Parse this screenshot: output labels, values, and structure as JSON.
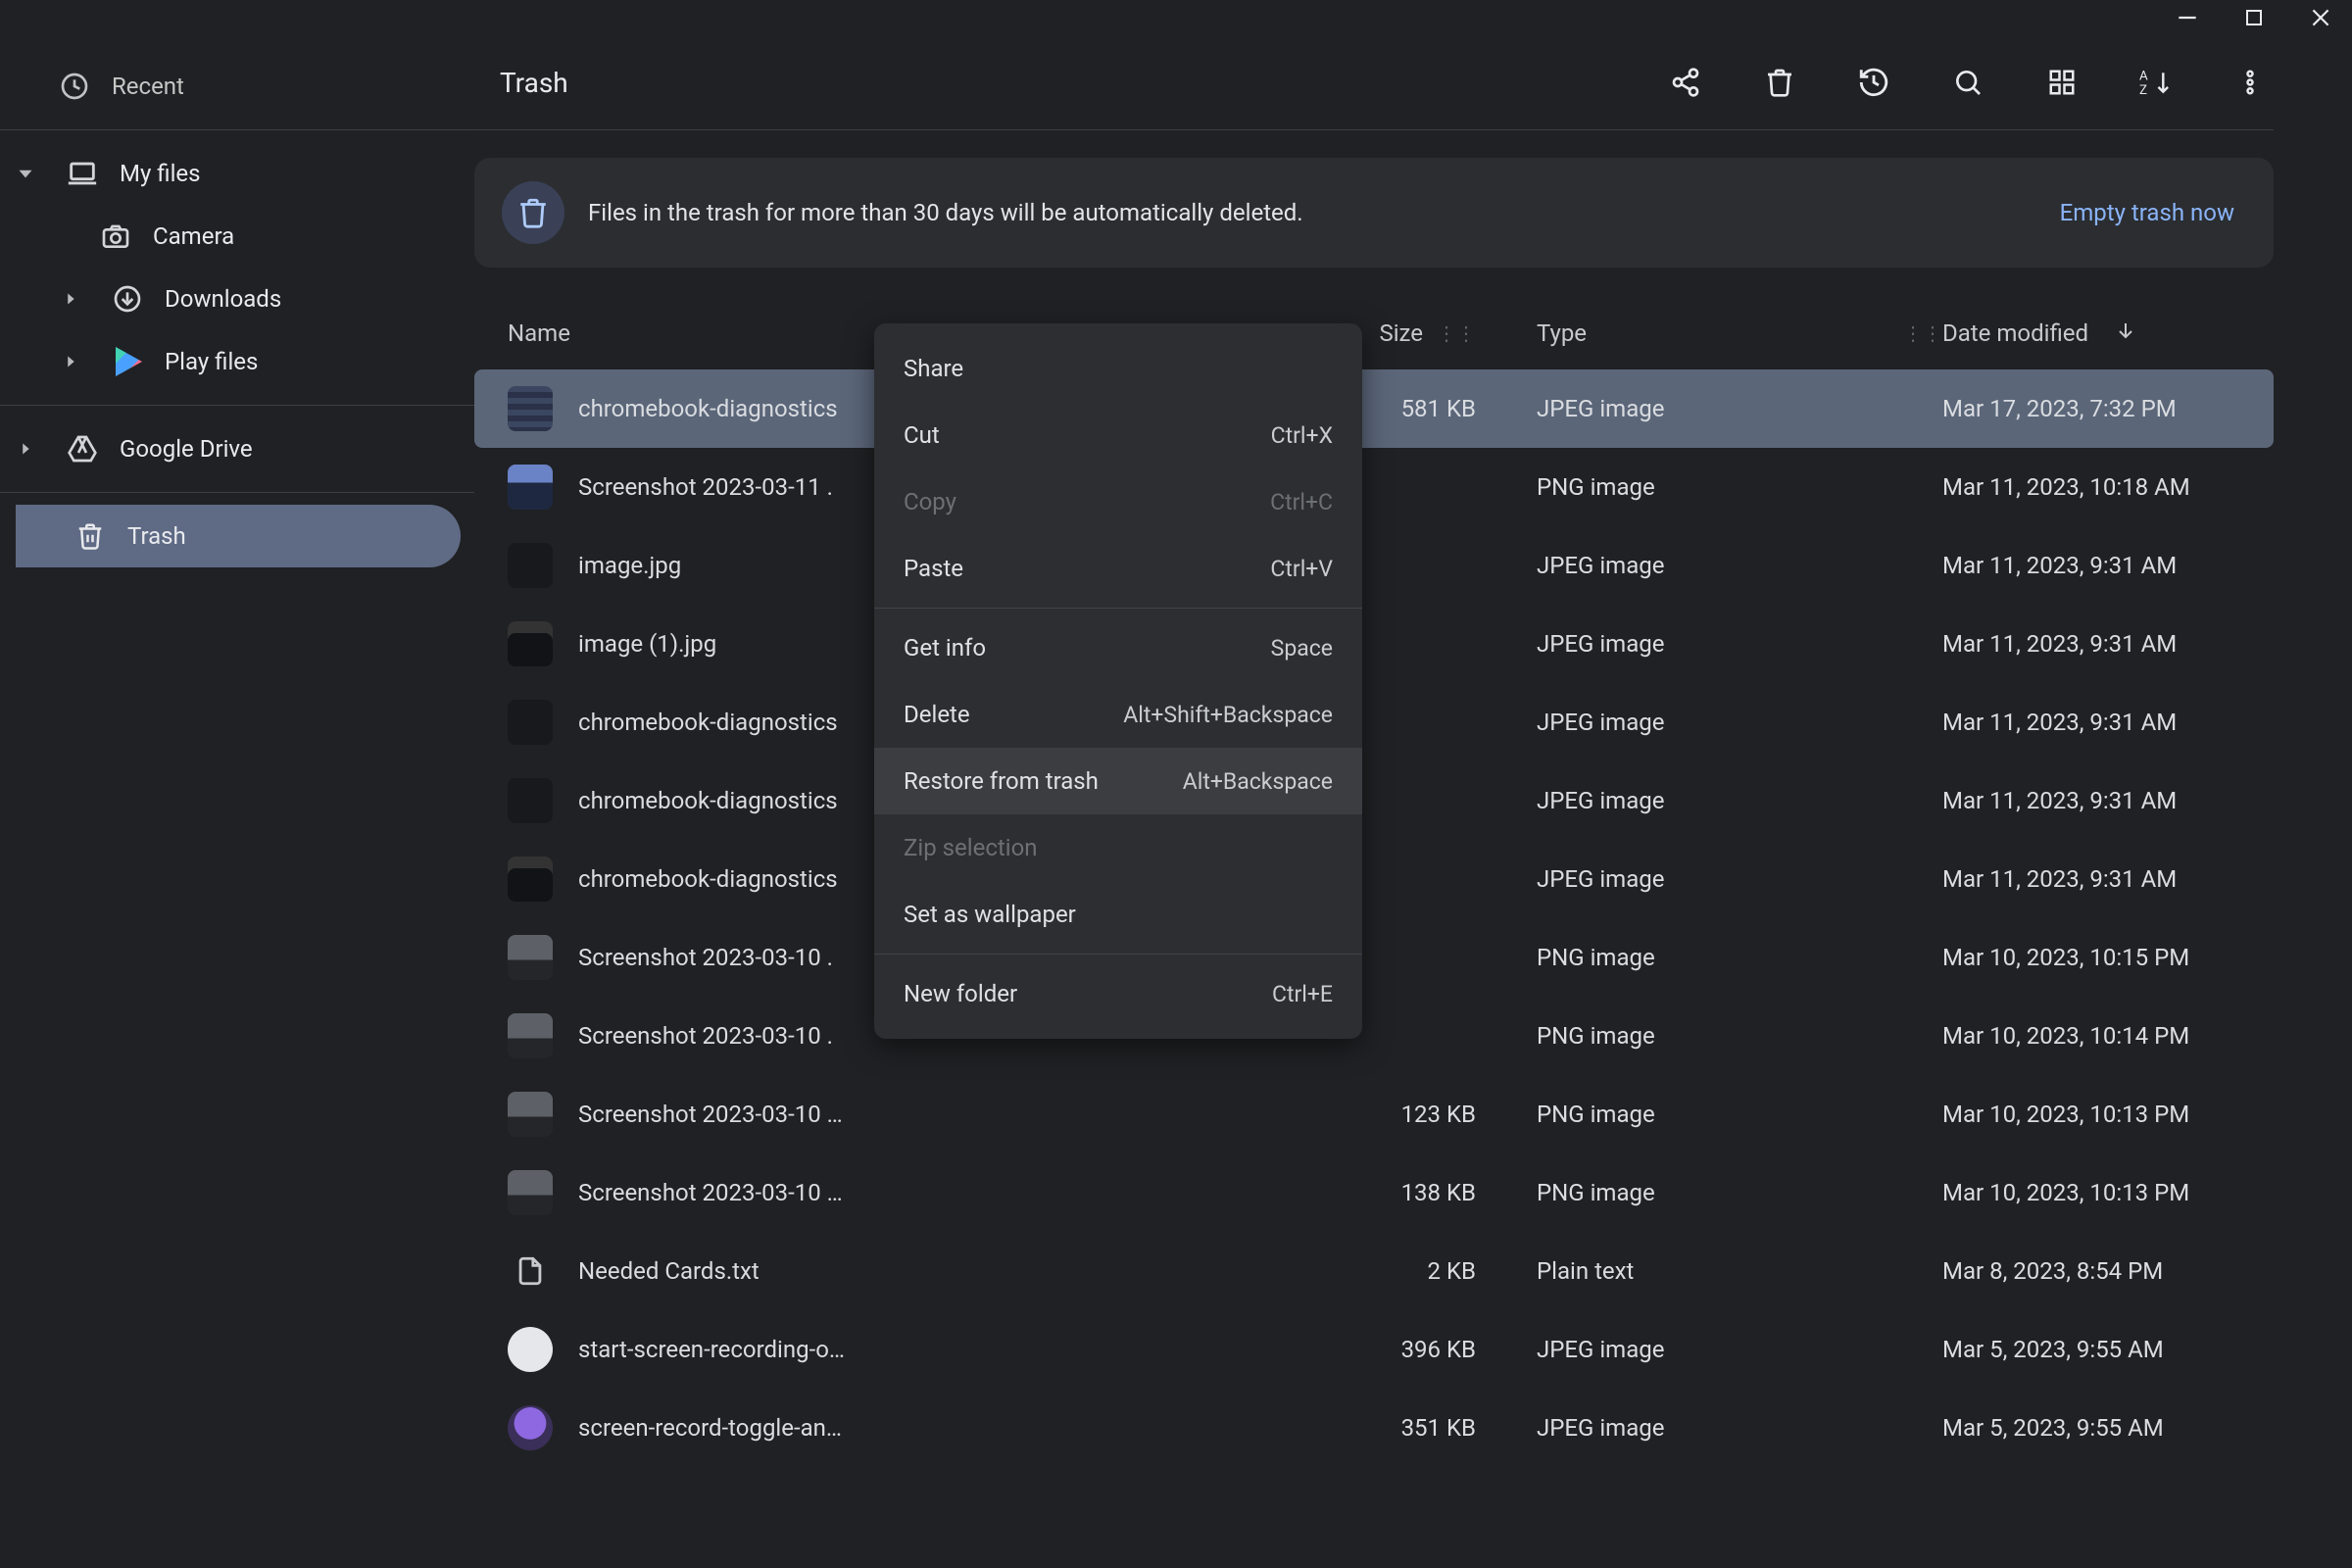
{
  "window": {
    "minimize": "−",
    "maximize": "❐",
    "close": "✕"
  },
  "sidebar": {
    "recent": "Recent",
    "myfiles": "My files",
    "camera": "Camera",
    "downloads": "Downloads",
    "playfiles": "Play files",
    "drive": "Google Drive",
    "trash": "Trash"
  },
  "header": {
    "title": "Trash"
  },
  "banner": {
    "text": "Files in the trash for more than 30 days will be automatically deleted.",
    "action": "Empty trash now"
  },
  "columns": {
    "name": "Name",
    "size": "Size",
    "type": "Type",
    "date": "Date modified"
  },
  "rows": [
    {
      "name": "chromebook-diagnostics",
      "size": "581 KB",
      "type": "JPEG image",
      "date": "Mar 17, 2023, 7:32 PM",
      "thumb": "jpeg-lines",
      "selected": true
    },
    {
      "name": "Screenshot 2023-03-11 .",
      "size": "",
      "type": "PNG image",
      "date": "Mar 11, 2023, 10:18 AM",
      "thumb": "png-bright"
    },
    {
      "name": "image.jpg",
      "size": "",
      "type": "JPEG image",
      "date": "Mar 11, 2023, 9:31 AM",
      "thumb": "jpeg-dark"
    },
    {
      "name": "image (1).jpg",
      "size": "",
      "type": "JPEG image",
      "date": "Mar 11, 2023, 9:31 AM",
      "thumb": "jpeg-dark2"
    },
    {
      "name": "chromebook-diagnostics",
      "size": "",
      "type": "JPEG image",
      "date": "Mar 11, 2023, 9:31 AM",
      "thumb": "jpeg-dark",
      "drag": true
    },
    {
      "name": "chromebook-diagnostics",
      "size": "",
      "type": "JPEG image",
      "date": "Mar 11, 2023, 9:31 AM",
      "thumb": "jpeg-dark"
    },
    {
      "name": "chromebook-diagnostics",
      "size": "",
      "type": "JPEG image",
      "date": "Mar 11, 2023, 9:31 AM",
      "thumb": "jpeg-dark2"
    },
    {
      "name": "Screenshot 2023-03-10 .",
      "size": "",
      "type": "PNG image",
      "date": "Mar 10, 2023, 10:15 PM",
      "thumb": "png-gray"
    },
    {
      "name": "Screenshot 2023-03-10 .",
      "size": "",
      "type": "PNG image",
      "date": "Mar 10, 2023, 10:14 PM",
      "thumb": "png-gray"
    },
    {
      "name": "Screenshot 2023-03-10 …",
      "size": "123 KB",
      "type": "PNG image",
      "date": "Mar 10, 2023, 10:13 PM",
      "thumb": "png-gray"
    },
    {
      "name": "Screenshot 2023-03-10 …",
      "size": "138 KB",
      "type": "PNG image",
      "date": "Mar 10, 2023, 10:13 PM",
      "thumb": "png-gray"
    },
    {
      "name": "Needed Cards.txt",
      "size": "2 KB",
      "type": "Plain text",
      "date": "Mar 8, 2023, 8:54 PM",
      "thumb": "doc"
    },
    {
      "name": "start-screen-recording-o…",
      "size": "396 KB",
      "type": "JPEG image",
      "date": "Mar 5, 2023, 9:55 AM",
      "thumb": "round-white"
    },
    {
      "name": "screen-record-toggle-an…",
      "size": "351 KB",
      "type": "JPEG image",
      "date": "Mar 5, 2023, 9:55 AM",
      "thumb": "round-purple"
    }
  ],
  "contextMenu": [
    {
      "label": "Share",
      "shortcut": "",
      "type": "item"
    },
    {
      "label": "Cut",
      "shortcut": "Ctrl+X",
      "type": "item"
    },
    {
      "label": "Copy",
      "shortcut": "Ctrl+C",
      "type": "disabled"
    },
    {
      "label": "Paste",
      "shortcut": "Ctrl+V",
      "type": "item"
    },
    {
      "type": "sep"
    },
    {
      "label": "Get info",
      "shortcut": "Space",
      "type": "item"
    },
    {
      "label": "Delete",
      "shortcut": "Alt+Shift+Backspace",
      "type": "item"
    },
    {
      "label": "Restore from trash",
      "shortcut": "Alt+Backspace",
      "type": "hover"
    },
    {
      "label": "Zip selection",
      "shortcut": "",
      "type": "disabled"
    },
    {
      "label": "Set as wallpaper",
      "shortcut": "",
      "type": "item"
    },
    {
      "type": "sep"
    },
    {
      "label": "New folder",
      "shortcut": "Ctrl+E",
      "type": "item"
    }
  ]
}
